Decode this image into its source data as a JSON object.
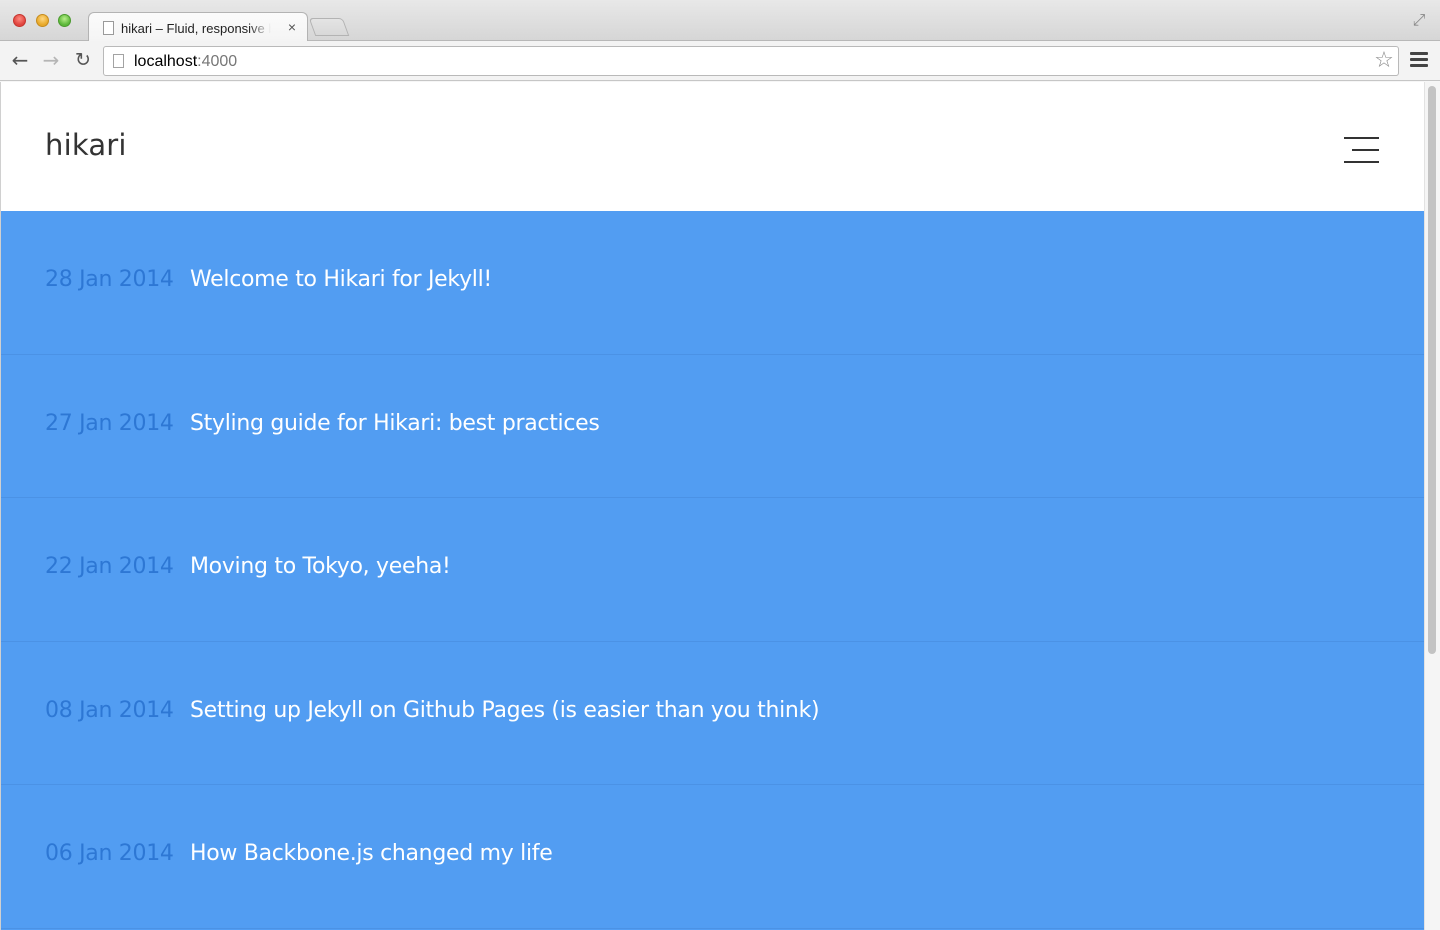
{
  "browser": {
    "tab_title": "hikari – Fluid, responsive blog theme",
    "tab_close": "×",
    "url_host": "localhost",
    "url_port": ":4000",
    "icons": {
      "back": "arrow-left-icon",
      "forward": "arrow-right-icon",
      "reload": "reload-icon",
      "bookmark": "star-icon",
      "menu": "hamburger-menu-icon",
      "fullscreen": "expand-icon"
    }
  },
  "site": {
    "title": "hikari",
    "accent_color": "#529df2",
    "date_color": "#2d77d4"
  },
  "posts": [
    {
      "date": "28 Jan 2014",
      "title": "Welcome to Hikari for Jekyll!"
    },
    {
      "date": "27 Jan 2014",
      "title": "Styling guide for Hikari: best practices"
    },
    {
      "date": "22 Jan 2014",
      "title": "Moving to Tokyo, yeeha!"
    },
    {
      "date": "08 Jan 2014",
      "title": "Setting up Jekyll on Github Pages (is easier than you think)"
    },
    {
      "date": "06 Jan 2014",
      "title": "How Backbone.js changed my life"
    }
  ]
}
